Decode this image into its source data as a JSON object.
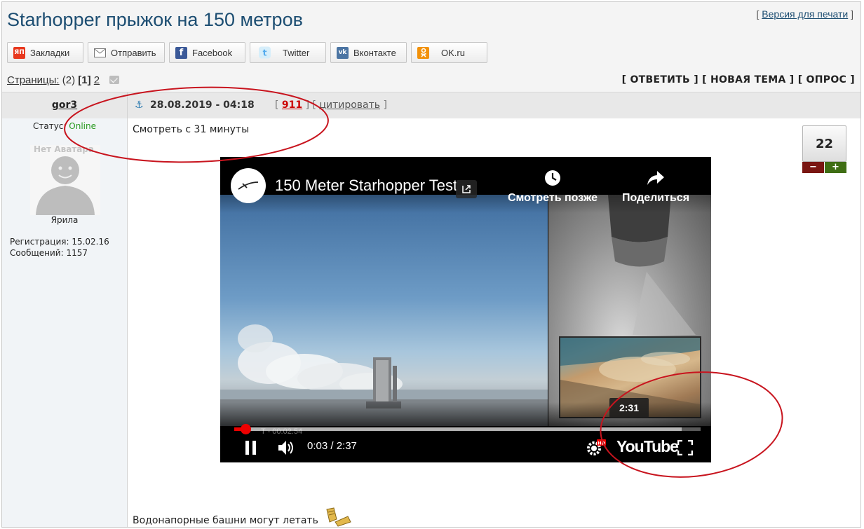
{
  "header": {
    "title": "Starhopper прыжок на 150 метров",
    "print_open": "[ ",
    "print_label": "Версия для печати",
    "print_close": " ]"
  },
  "share": {
    "buttons": [
      {
        "label": "Закладки",
        "icon": "yandex-bookmarks-icon",
        "icon_text": "ЯП",
        "color": "#e8381e"
      },
      {
        "label": "Отправить",
        "icon": "mail-icon",
        "color": "#7a7a7a"
      },
      {
        "label": "Facebook",
        "icon": "facebook-icon",
        "icon_text": "f",
        "color": "#3b5998"
      },
      {
        "label": "Twitter",
        "icon": "twitter-icon",
        "color": "#55acee"
      },
      {
        "label": "Вконтакте",
        "icon": "vk-icon",
        "icon_text": "vk",
        "color": "#4c75a3"
      },
      {
        "label": "OK.ru",
        "icon": "odnoklassniki-icon",
        "color": "#f2910a"
      }
    ]
  },
  "pagination": {
    "label": "Страницы:",
    "count": "(2)",
    "current": "[1]",
    "next": "2"
  },
  "actions": {
    "reply": "[ ОТВЕТИТЬ ]",
    "new_topic": "[ НОВАЯ ТЕМА ]",
    "poll": "[ ОПРОС ]"
  },
  "post": {
    "author": "gor3",
    "date": "28.08.2019 - 04:18",
    "number": "911",
    "quote_label": "цитировать",
    "status_label": "Статус:",
    "status_value": "Online",
    "avatar_text": "Нет Аватара",
    "rank": "Ярила",
    "registration": "Регистрация: 15.02.16",
    "messages": "Сообщений: 1157",
    "text_top": "Смотреть с 31 минуты",
    "text_bottom": "Водонапорные башни могут летать",
    "rating": "22",
    "rating_minus": "−",
    "rating_plus": "+"
  },
  "video": {
    "title": "150 Meter Starhopper Test",
    "watch_later": "Смотреть позже",
    "share": "Поделиться",
    "time": "0:03 / 2:37",
    "hover_time": "2:31",
    "ghost_time": "T - 00:02.54",
    "youtube": "YouTube",
    "progress": 0.02,
    "buffered": 0.96
  },
  "colors": {
    "title": "#1d4e72",
    "online": "#2a9a22",
    "annotation": "#c8141e"
  }
}
